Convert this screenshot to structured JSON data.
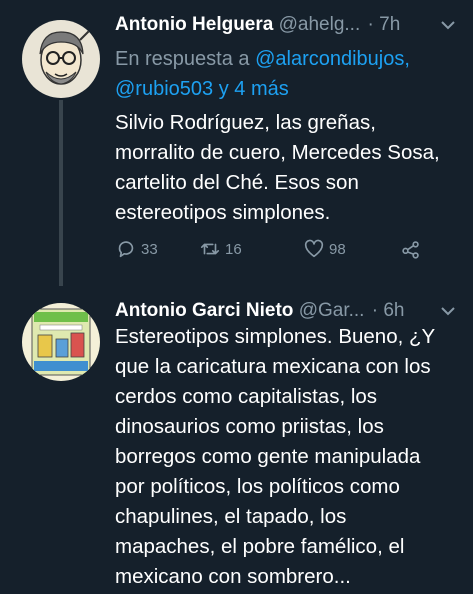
{
  "tweets": [
    {
      "author_name": "Antonio Helguera",
      "handle": "@ahelg...",
      "time": "· 7h",
      "reply_prefix": "En respuesta a",
      "reply_mention": "@alarcondibujos,",
      "reply_more": "@rubio503 y 4 más",
      "text": "Silvio Rodríguez, las greñas,\nmorralito de cuero, Mercedes Sosa,\ncartelito del Ché. Esos son\nestereotipos simplones.",
      "reply_count": "33",
      "retweet_count": "16",
      "like_count": "98"
    },
    {
      "author_name": "Antonio Garci Nieto",
      "handle": "@Gar...",
      "time": "· 6h",
      "text": "Estereotipos simplones. Bueno, ¿Y\nque la caricatura mexicana con los\ncerdos como capitalistas, los\ndinosaurios como priistas, los\nborregos como gente manipulada\npor políticos, los políticos como\nchapulines, el tapado, los\nmapaches, el pobre famélico, el\nmexicano con sombrero..."
    }
  ],
  "colors": {
    "background": "#15202b",
    "text_secondary": "#8899a6",
    "link": "#1da1f2",
    "thread_line": "#38444d"
  },
  "icons": {
    "reply": "reply-icon",
    "retweet": "retweet-icon",
    "like": "heart-icon",
    "share": "share-icon",
    "more": "chevron-down-icon"
  }
}
